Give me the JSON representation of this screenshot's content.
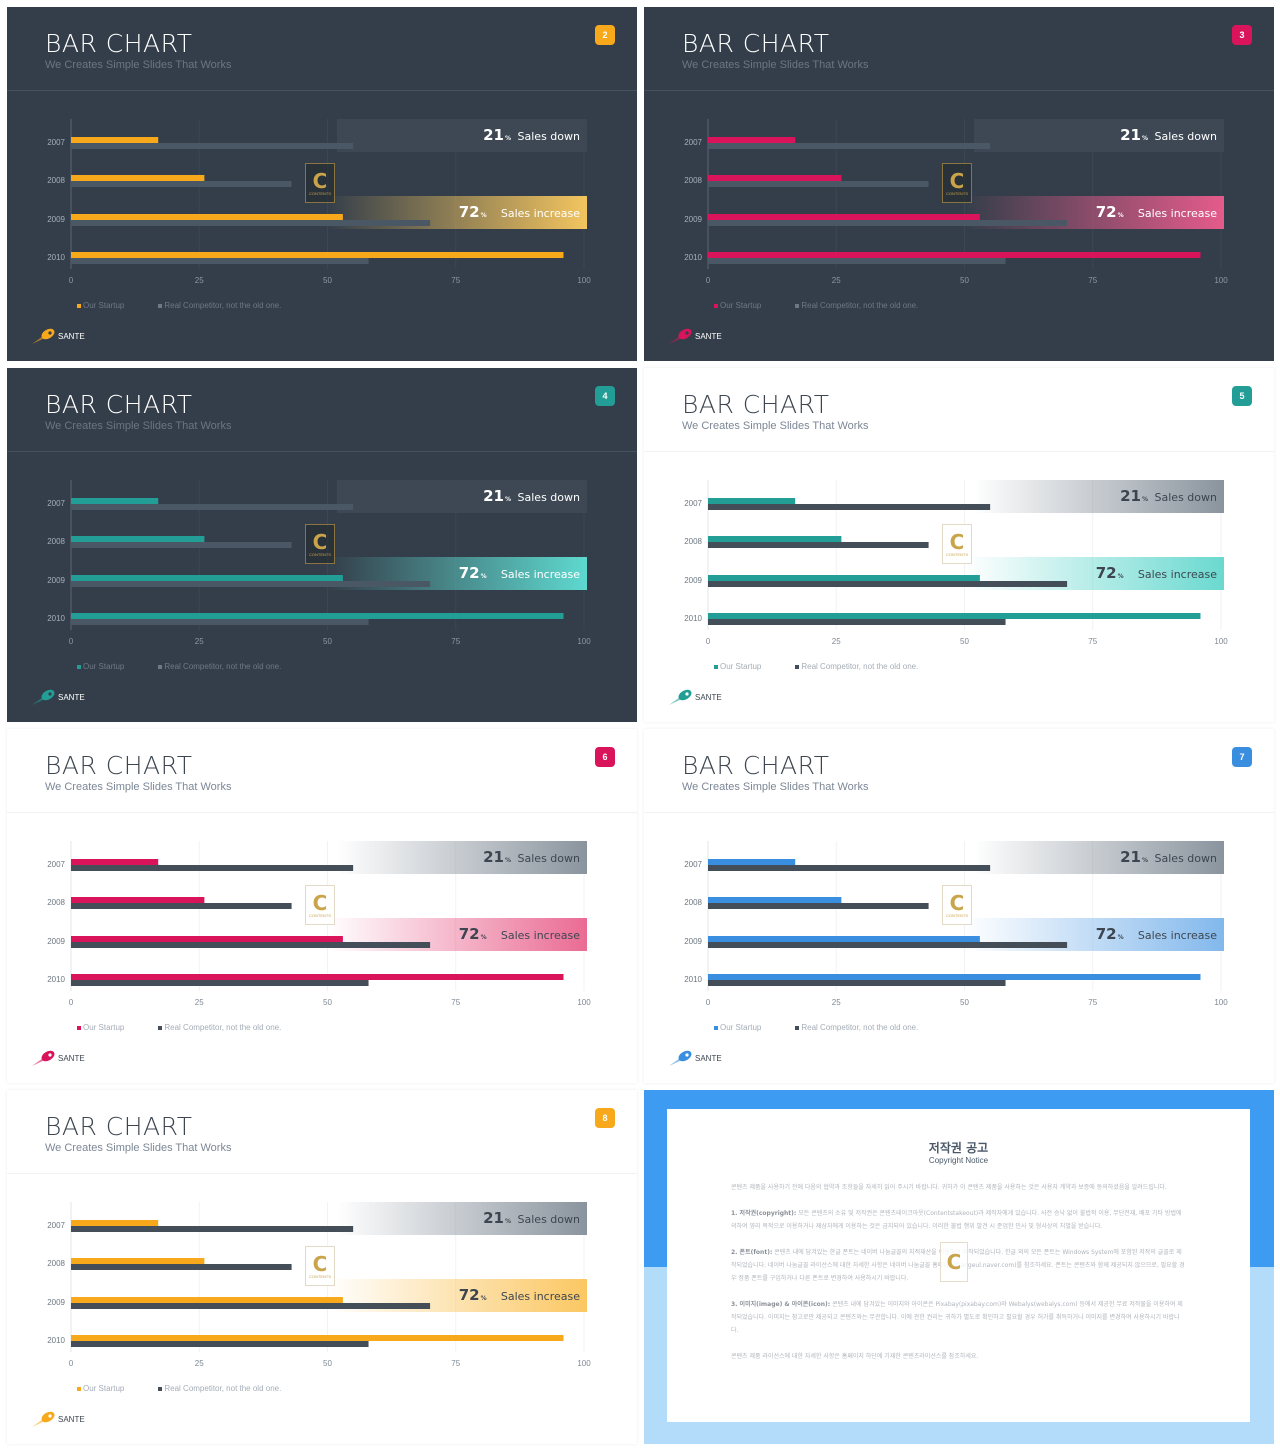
{
  "slides": [
    {
      "number": "2",
      "theme": "dark",
      "accent": "#f8a91b",
      "competitor_color": "#4a5765",
      "down_band": "#3e4955",
      "up_band": "#f3c55f",
      "title": "BAR CHART",
      "subtitle": "We Creates Simple Slides That Works"
    },
    {
      "number": "3",
      "theme": "dark",
      "accent": "#d9145a",
      "competitor_color": "#4a5765",
      "down_band": "#3e4955",
      "up_band": "#e55b8b",
      "title": "BAR CHART",
      "subtitle": "We Creates Simple Slides That Works"
    },
    {
      "number": "4",
      "theme": "dark",
      "accent": "#229e96",
      "competitor_color": "#4a5765",
      "down_band": "#3e4955",
      "up_band": "#5ed9cf",
      "title": "BAR CHART",
      "subtitle": "We Creates Simple Slides That Works"
    },
    {
      "number": "5",
      "theme": "light",
      "accent": "#229e96",
      "competitor_color": "#434e59",
      "down_band": "#8a949e",
      "up_band": "#6ad9d0",
      "title": "BAR CHART",
      "subtitle": "We Creates Simple Slides That Works"
    },
    {
      "number": "6",
      "theme": "light",
      "accent": "#d9145a",
      "competitor_color": "#434e59",
      "down_band": "#8a949e",
      "up_band": "#ea6b94",
      "title": "BAR CHART",
      "subtitle": "We Creates Simple Slides That Works"
    },
    {
      "number": "7",
      "theme": "light",
      "accent": "#3a8ee0",
      "competitor_color": "#434e59",
      "down_band": "#8a949e",
      "up_band": "#82b8ec",
      "title": "BAR CHART",
      "subtitle": "We Creates Simple Slides That Works"
    },
    {
      "number": "8",
      "theme": "light",
      "accent": "#f8a91b",
      "competitor_color": "#434e59",
      "down_band": "#8a949e",
      "up_band": "#fbc762",
      "title": "BAR CHART",
      "subtitle": "We Creates Simple Slides That Works"
    }
  ],
  "brand": {
    "name": "SANTE",
    "icon": "rocket-icon"
  },
  "watermark": {
    "letter": "C",
    "text": "CONTENTS"
  },
  "chart_data": {
    "type": "bar",
    "orientation": "horizontal",
    "categories": [
      "2007",
      "2008",
      "2009",
      "2010"
    ],
    "series": [
      {
        "name": "Our Startup",
        "values": [
          17,
          26,
          53,
          96
        ]
      },
      {
        "name": "Real Competitor, not the old one.",
        "values": [
          55,
          43,
          70,
          58
        ]
      }
    ],
    "xlim": [
      0,
      100
    ],
    "xticks": [
      "0",
      "25",
      "50",
      "75",
      "100"
    ],
    "grid": true,
    "legend": "bottom-left",
    "annotations": [
      {
        "category": "2007",
        "value": "21",
        "unit": "%",
        "label": "Sales down"
      },
      {
        "category": "2009",
        "value": "72",
        "unit": "%",
        "label": "Sales increase"
      }
    ]
  },
  "copyright": {
    "title": "저작권 공고",
    "subtitle": "Copyright Notice",
    "intro": "콘텐츠 제품을 사용하기 전에 다음의 협약과 조항들을 자세히 읽어 주시기 바랍니다. 귀하가 이 콘텐츠 제품을 사용하는 것은 사용자 계약과 보증에 동의하셨음을 알려드립니다.",
    "sections": [
      {
        "head": "1. 저작권(copyright):",
        "text": "모든 콘텐츠의 소유 및 저작권은 콘텐츠테이크아웃(Contentstakeout)과 제작자에게 있습니다. 사전 승낙 없이 불법적 이용, 무단전재, 배포 기타 방법에 의하여 영리 목적으로 이용하거나 제삼자에게 이용하는 것은 금지되어 있습니다. 이러한 불법 행위 발견 시 준엄한 민사 및 형사상의 처벌을 받습니다."
      },
      {
        "head": "2. 폰트(font):",
        "text": "콘텐츠 내에 담겨있는 한글 폰트는 네이버 나눔글꼴의 지적재산을 이용하여 제작되었습니다. 한글 외의 모든 폰트는 Windows System에 포함된 저작의 글꼴로 제작되었습니다. 네이버 나눔글꼴 라이선스에 대한 자세한 사항은 네이버 나눔글꼴 홈페이지(hangeul.naver.com)를 참조하세요. 폰트는 콘텐츠와 함께 제공되지 않으므로, 필요할 경우 정품 폰트를 구입하거나 다른 폰트로 변경하여 사용하시기 바랍니다."
      },
      {
        "head": "3. 이미지(image) & 아이콘(icon):",
        "text": "콘텐츠 내에 담겨있는 이미지와 아이콘은 Pixabay(pixabay.com)와 Webalys(webalys.com) 등에서 제공한 무료 저작물을 이용하여 제작되었습니다. 이미지는 참고로만 제공되고 콘텐츠와는 무관합니다. 이에 관한 권리는 귀하가 별도로 확인하고 필요할 경우 허가를 취득하거나 이미지를 변경하여 사용하시기 바랍니다."
      }
    ],
    "footer": "콘텐츠 제품 라이선스에 대한 자세한 사항은 홈페이지 하단에 기재한 콘텐츠라이선스를 참조하세요."
  }
}
